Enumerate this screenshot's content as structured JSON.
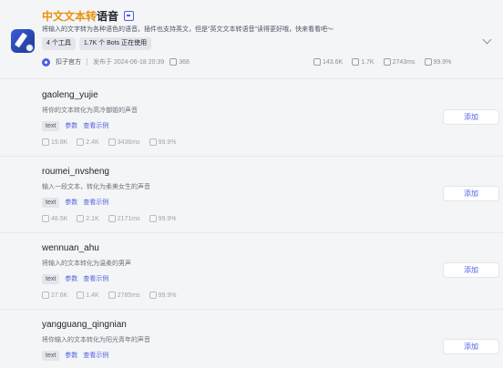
{
  "plugin": {
    "title_highlight": "中文文本转",
    "title_rest": "语音",
    "description": "将输入的文字转为各种语色的语音。插件也支持英文，但是\"英文文本转语音\"读得更好哦，快来看看吧～",
    "tags": [
      "4 个工具",
      "1.7K 个 Bots 正在使用"
    ],
    "author": "扣子官方",
    "published": "发布于 2024-06-18 20:39",
    "favorites": "368",
    "stats": {
      "calls": "143.6K",
      "bots": "1.7K",
      "latency": "2743ms",
      "success": "99.9%"
    }
  },
  "tools": [
    {
      "name": "gaoleng_yujie",
      "description": "将你的文本转化为高冷御姐的声音",
      "param_tag": "text",
      "params_label": "参数",
      "example_label": "查看示例",
      "calls": "19.8K",
      "bots": "2.4K",
      "latency": "3436ms",
      "success": "99.9%",
      "add_label": "添加"
    },
    {
      "name": "roumei_nvsheng",
      "description": "输入一段文本，转化为柔美女生的声音",
      "param_tag": "text",
      "params_label": "参数",
      "example_label": "查看示例",
      "calls": "48.5K",
      "bots": "2.1K",
      "latency": "2171ms",
      "success": "99.9%",
      "add_label": "添加"
    },
    {
      "name": "wennuan_ahu",
      "description": "将输入的文本转化为温柔的男声",
      "param_tag": "text",
      "params_label": "参数",
      "example_label": "查看示例",
      "calls": "27.6K",
      "bots": "1.4K",
      "latency": "2785ms",
      "success": "99.9%",
      "add_label": "添加"
    },
    {
      "name": "yangguang_qingnian",
      "description": "将你输入的文本转化为阳光青年的声音",
      "param_tag": "text",
      "params_label": "参数",
      "example_label": "查看示例",
      "add_label": "添加"
    }
  ]
}
